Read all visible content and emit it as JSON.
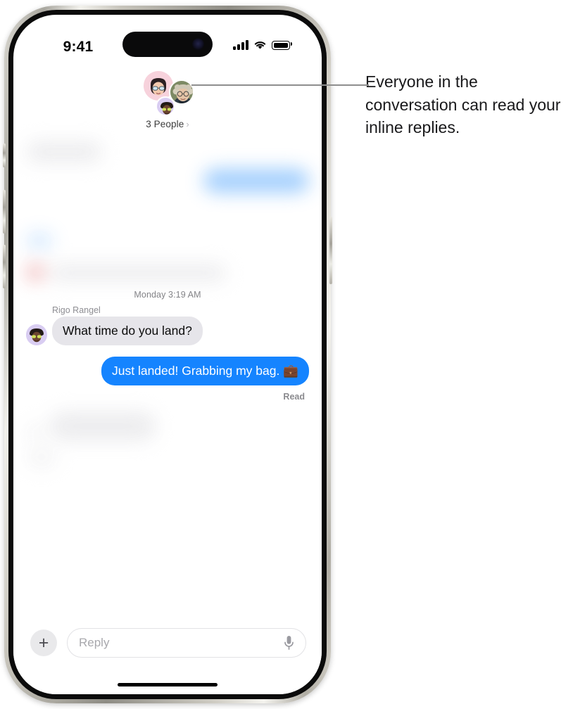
{
  "status_bar": {
    "time": "9:41",
    "cellular_icon": "cellular-bars-icon",
    "wifi_icon": "wifi-icon",
    "battery_icon": "battery-full-icon"
  },
  "conversation_header": {
    "participants_label": "3 People",
    "chevron": "›",
    "avatars": [
      {
        "name": "memoji-pink-avatar",
        "bg": "#f7d2dc"
      },
      {
        "name": "photo-avatar",
        "bg": "#8a8f6d"
      },
      {
        "name": "memoji-purple-avatar",
        "bg": "#d9cdf2"
      }
    ]
  },
  "conversation": {
    "timestamp": "Monday 3:19 AM",
    "messages": [
      {
        "sender": "Rigo Rangel",
        "text": "What time do you land?",
        "direction": "incoming"
      },
      {
        "sender": "",
        "text": "Just landed! Grabbing my bag. 💼",
        "direction": "outgoing"
      }
    ],
    "read_receipt": "Read"
  },
  "input_bar": {
    "add_label": "+",
    "reply_placeholder": "Reply",
    "mic_icon": "microphone-icon"
  },
  "callout": {
    "text": "Everyone in the conversation can read your inline replies."
  },
  "colors": {
    "imessage_blue": "#1584ff",
    "incoming_gray": "#e6e5ea",
    "secondary_text": "#8e8e93"
  }
}
